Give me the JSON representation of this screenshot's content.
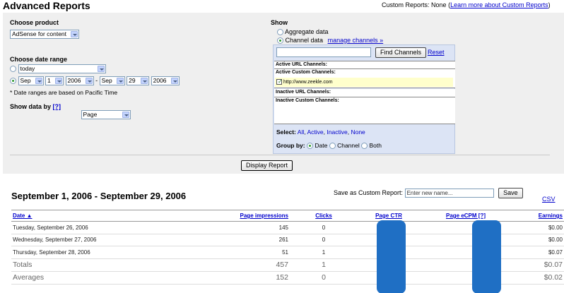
{
  "header": {
    "title": "Advanced Reports",
    "custom_reports_label": "Custom Reports:",
    "custom_reports_value": "None",
    "learn_more_link": "Learn more about Custom Reports"
  },
  "choose_product": {
    "label": "Choose product",
    "selected": "AdSense for content"
  },
  "date_range": {
    "label": "Choose date range",
    "preset_selected": "today",
    "from_month": "Sep",
    "from_day": "1",
    "from_year": "2006",
    "separator": "-",
    "to_month": "Sep",
    "to_day": "29",
    "to_year": "2006",
    "note": "* Date ranges are based on Pacific Time"
  },
  "show_data_by": {
    "label": "Show data by",
    "help_link": "[?]",
    "selected": "Page"
  },
  "show": {
    "label": "Show",
    "option_aggregate": "Aggregate data",
    "option_channel": "Channel data",
    "manage_channels_link": "manage channels »",
    "find_channels_button": "Find Channels",
    "reset_link": "Reset",
    "active_url_channels": "Active URL Channels:",
    "active_custom_channels": "Active Custom Channels:",
    "channel_item": "http://www.zeekle.com",
    "inactive_url_channels": "Inactive URL Channels:",
    "inactive_custom_channels": "Inactive Custom Channels:",
    "select_label": "Select:",
    "select_all": "All",
    "select_active": "Active",
    "select_inactive": "Inactive",
    "select_none": "None",
    "group_by_label": "Group by:",
    "group_date": "Date",
    "group_channel": "Channel",
    "group_both": "Both"
  },
  "display_report_button": "Display Report",
  "report": {
    "title": "September 1, 2006 - September 29, 2006",
    "save_label": "Save as Custom Report:",
    "save_placeholder": "Enter new name...",
    "save_button": "Save",
    "csv_link": "CSV",
    "columns": {
      "date": "Date ▲",
      "impressions": "Page impressions",
      "clicks": "Clicks",
      "ctr": "Page CTR",
      "ecpm": "Page eCPM [?]",
      "earnings": "Earnings"
    },
    "rows": [
      {
        "date": "Tuesday, September 26, 2006",
        "impressions": "145",
        "clicks": "0",
        "earnings": "$0.00"
      },
      {
        "date": "Wednesday, September 27, 2006",
        "impressions": "261",
        "clicks": "0",
        "earnings": "$0.00"
      },
      {
        "date": "Thursday, September 28, 2006",
        "impressions": "51",
        "clicks": "1",
        "earnings": "$0.07"
      }
    ],
    "totals": {
      "label": "Totals",
      "impressions": "457",
      "clicks": "1",
      "earnings": "$0.07"
    },
    "averages": {
      "label": "Averages",
      "impressions": "152",
      "clicks": "0",
      "earnings": "$0.02"
    }
  },
  "colors": {
    "panel_bg": "#efefef",
    "link": "#0000cc",
    "redaction": "#1f6fc4",
    "channel_box": "#dce4f5",
    "channel_item_bg": "#ffffcc"
  }
}
